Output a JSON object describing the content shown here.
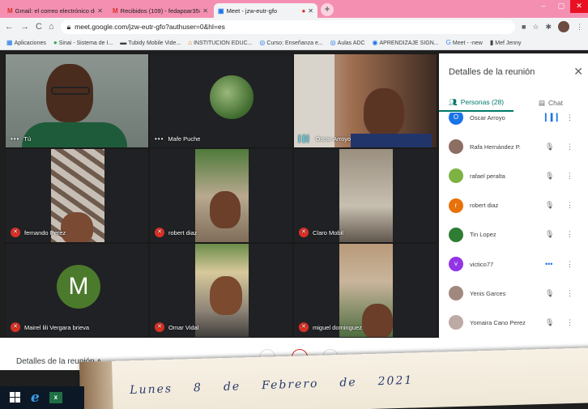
{
  "browser": {
    "tabs": [
      {
        "favicon": "M",
        "title": "Gmail: el correo electrónico de G"
      },
      {
        "favicon": "M",
        "title": "Recibidos (109) - fedapoar35@gm"
      },
      {
        "favicon": "meet-icon",
        "title": "Meet - jzw-eutr-gfo"
      }
    ],
    "url": "meet.google.com/jzw-eutr-gfo?authuser=0&hl=es",
    "bookmarks": [
      "Aplicaciones",
      "Sinai - Sistema de I...",
      "Tubidy Mobile Vide...",
      "INSTITUCION EDUC...",
      "Curso: Enseñanza e...",
      "Aulas ADC",
      "APRENDIZAJE SIGN...",
      "Meet - -new",
      "Mef Jenny"
    ]
  },
  "participants_grid": [
    {
      "name": "Tú",
      "status": "more"
    },
    {
      "name": "Mafe Puche",
      "status": "more"
    },
    {
      "name": "Oscar Arroyo",
      "status": "speaking"
    },
    {
      "name": "fernando Perez",
      "status": "muted"
    },
    {
      "name": "robert diaz",
      "status": "muted"
    },
    {
      "name": "Claro Mobil",
      "status": "muted"
    },
    {
      "name": "Mairel lili Vergara brieva",
      "status": "muted",
      "initial": "M"
    },
    {
      "name": "Omar Vidal",
      "status": "muted"
    },
    {
      "name": "miguel dominguez",
      "status": "muted"
    }
  ],
  "panel": {
    "title": "Detalles de la reunión",
    "tab_people": "Personas (28)",
    "tab_chat": "Chat",
    "people": [
      {
        "name": "Oscar Arroyo",
        "avatar": "O",
        "color": "#1a73e8",
        "mic": "speaking"
      },
      {
        "name": "Rafa Hernández P.",
        "avatar": "",
        "color": "#8d6e63",
        "mic": "muted"
      },
      {
        "name": "rafael peralta",
        "avatar": "",
        "color": "#7cb342",
        "mic": "muted"
      },
      {
        "name": "robert diaz",
        "avatar": "r",
        "color": "#e8710a",
        "mic": "muted"
      },
      {
        "name": "Tin Lopez",
        "avatar": "",
        "color": "#2e7d32",
        "mic": "muted"
      },
      {
        "name": "victico77",
        "avatar": "v",
        "color": "#9334e6",
        "mic": "active"
      },
      {
        "name": "Yenis Garces",
        "avatar": "",
        "color": "#a1887f",
        "mic": "muted"
      },
      {
        "name": "Yomaira Cano Perez",
        "avatar": "",
        "color": "#bcaaa4",
        "mic": "muted"
      }
    ]
  },
  "bottom": {
    "details_label": "Detalles de la reunión"
  },
  "note": {
    "words": [
      "Lunes",
      "8",
      "de",
      "Febrero",
      "de",
      "2021"
    ]
  }
}
